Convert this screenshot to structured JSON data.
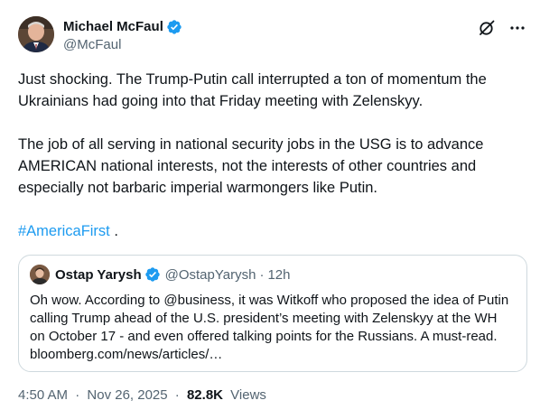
{
  "author": {
    "name": "Michael McFaul",
    "handle": "@McFaul"
  },
  "tweet": {
    "paragraph1": "Just shocking. The Trump-Putin call interrupted a ton of momentum the Ukrainians had going into that Friday meeting with Zelenskyy.",
    "paragraph2": "The job of all serving in national security jobs in the USG is to advance AMERICAN national interests, not the interests of other countries and especially not barbaric imperial warmongers like Putin.",
    "hashtag": "#AmericaFirst",
    "after_hashtag": " ."
  },
  "quote": {
    "name": "Ostap Yarysh",
    "handle": "@OstapYarysh",
    "separator": "·",
    "time": "12h",
    "text": "Oh wow. According to @business, it was Witkoff who proposed the idea of Putin calling Trump ahead of the U.S. president’s meeting with Zelenskyy at the WH on October 17 - and even offered talking points for the Russians. A must-read. bloomberg.com/news/articles/…"
  },
  "meta": {
    "time": "4:50 AM",
    "separator": "·",
    "date": "Nov 26, 2025",
    "views_count": "82.8K",
    "views_label": "Views"
  },
  "icons": {
    "verified": "verified-badge-icon",
    "grok": "grok-icon",
    "more": "more-icon"
  },
  "colors": {
    "verified": "#1d9bf0",
    "link": "#1d9bf0",
    "secondary_text": "#536471",
    "border": "#cfd9de"
  }
}
